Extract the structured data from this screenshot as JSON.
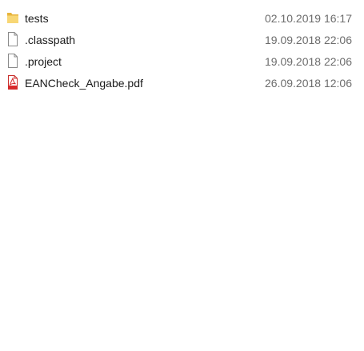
{
  "files": [
    {
      "name": "tests",
      "modified": "02.10.2019 16:17",
      "icon": "folder-icon"
    },
    {
      "name": ".classpath",
      "modified": "19.09.2018 22:06",
      "icon": "file-icon"
    },
    {
      "name": ".project",
      "modified": "19.09.2018 22:06",
      "icon": "file-icon"
    },
    {
      "name": "EANCheck_Angabe.pdf",
      "modified": "26.09.2018 12:06",
      "icon": "pdf-icon"
    }
  ],
  "colors": {
    "folder": "#f8d775",
    "pdf": "#d9292b",
    "date_text": "#6d6d6d",
    "name_text": "#1a1a1a"
  }
}
